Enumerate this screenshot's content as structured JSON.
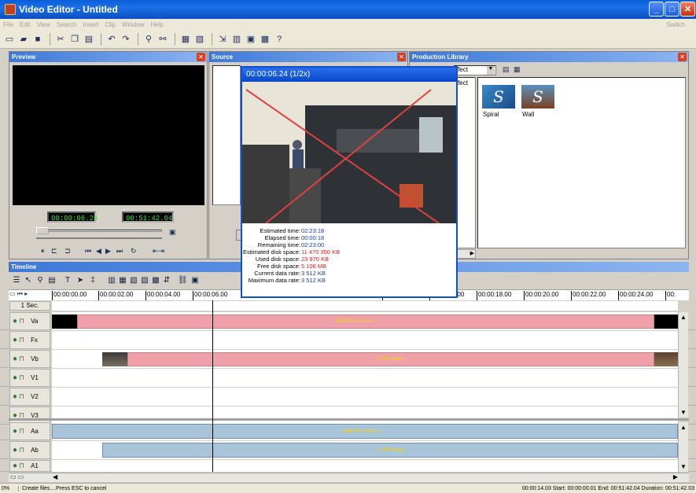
{
  "app": {
    "title": "Video Editor - Untitled"
  },
  "menu": {
    "items": [
      "File",
      "Edit",
      "View",
      "Search",
      "Insert",
      "Clip",
      "Window",
      "Help"
    ],
    "switch_label": "Switch"
  },
  "toolbar": {
    "icons": [
      "new-icon",
      "open-icon",
      "save-icon",
      "cut-icon",
      "copy-icon",
      "paste-icon",
      "undo-icon",
      "redo-icon",
      "find-icon",
      "binoculars-icon",
      "properties-icon",
      "tools-icon",
      "export-icon",
      "library-icon",
      "capture-icon",
      "effects-icon",
      "help-icon"
    ]
  },
  "preview": {
    "title": "Preview",
    "timecode_current": "00:00:06.24",
    "timecode_total": "00:51:42.04"
  },
  "source": {
    "title": "Source"
  },
  "library": {
    "title": "Production Library",
    "dropdown_value": "ffect",
    "side_label": "ffect",
    "items": [
      {
        "label": "Spiral",
        "glyph": "S"
      },
      {
        "label": "Wall",
        "glyph": "S"
      }
    ]
  },
  "timeline": {
    "title": "Timeline",
    "zoom_label": "1 Sec.",
    "ticks": [
      "00:00:00.00",
      "00:00:02.00",
      "00:00:04.00",
      "00:00:06.00",
      "2.00",
      "00:00:14.00",
      "00:00:16.00",
      "00:00:18.00",
      "00:00:20.00",
      "00:00:22.00",
      "00:00:24.00",
      "00:"
    ],
    "tracks": [
      {
        "name": "Va",
        "clip_label": "spd-2kb-ab9.avi"
      },
      {
        "name": "Fx",
        "clip_label": ""
      },
      {
        "name": "Vb",
        "clip_label": "1_005.mpg"
      },
      {
        "name": "V1",
        "clip_label": ""
      },
      {
        "name": "V2",
        "clip_label": ""
      },
      {
        "name": "V3",
        "clip_label": ""
      },
      {
        "name": "Aa",
        "clip_label": "spd-2kb-ab9.avi"
      },
      {
        "name": "Ab",
        "clip_label": "1_005.mpg"
      },
      {
        "name": "A1",
        "clip_label": ""
      }
    ]
  },
  "render_popup": {
    "title": "00:00:06.24 (1/2x)",
    "stats": [
      {
        "key": "Estimated time:",
        "value": "02:23:18",
        "highlight": false
      },
      {
        "key": "Elapsed time:",
        "value": "00:00:18",
        "highlight": false
      },
      {
        "key": "Remaining time:",
        "value": "02:23:00",
        "highlight": false
      },
      {
        "key": "Estimated disk space:",
        "value": "11 470 350 KB",
        "highlight": true
      },
      {
        "key": "Used disk space:",
        "value": "23 970 KB",
        "highlight": true
      },
      {
        "key": "Free disk space:",
        "value": "5 106 MB",
        "highlight": true
      },
      {
        "key": "Current data rate:",
        "value": "3 512 KB",
        "highlight": false
      },
      {
        "key": "Maximum data rate:",
        "value": "3 512 KB",
        "highlight": false
      }
    ]
  },
  "status": {
    "progress": "0%",
    "message": "Create files....Press ESC to cancel",
    "info": "00:00:14.03  Start: 00:00:00.01  End: 00:51:42.04  Duration: 00:51:42.03"
  }
}
